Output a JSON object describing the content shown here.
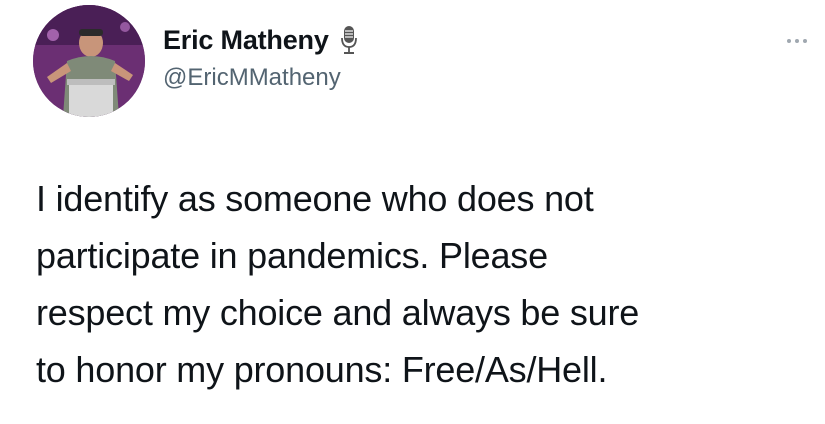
{
  "author": {
    "display_name": "Eric Matheny",
    "handle": "@EricMMatheny",
    "badge_icon": "microphone-icon",
    "avatar_bg": "#6b2f73"
  },
  "tweet": {
    "text": "I identify as someone who does not\nparticipate in pandemics. Please\nrespect my choice and always be sure\nto honor my pronouns: Free/As/Hell."
  },
  "actions": {
    "more_icon": "more-options-icon"
  },
  "colors": {
    "text": "#0f1419",
    "secondary": "#536471",
    "background": "#ffffff"
  }
}
